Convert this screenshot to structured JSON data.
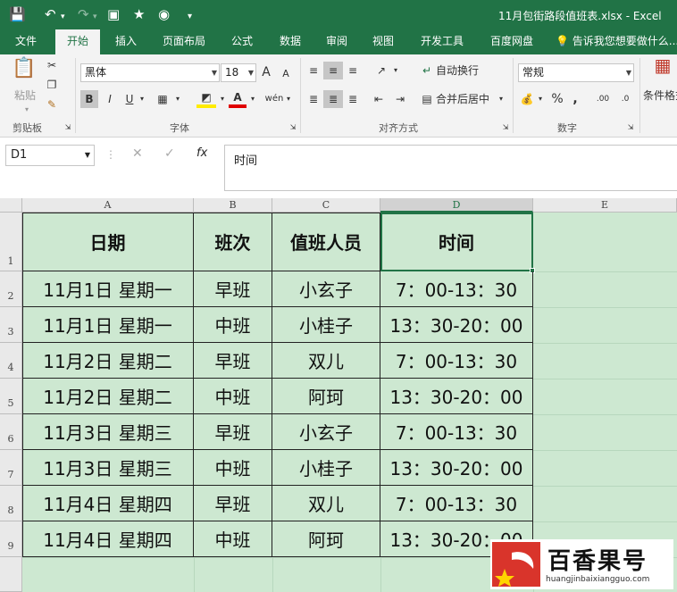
{
  "title_bar": {
    "doc_title": "11月包街路段值班表.xlsx - Excel"
  },
  "ribbon_tabs": [
    "文件",
    "开始",
    "插入",
    "页面布局",
    "公式",
    "数据",
    "审阅",
    "视图",
    "开发工具",
    "百度网盘"
  ],
  "tell_me": "告诉我您想要做什么...",
  "ribbon": {
    "paste_label": "粘贴",
    "clipboard_group": "剪贴板",
    "font_name": "黑体",
    "font_size": "18",
    "font_group": "字体",
    "wrap_label": "自动换行",
    "merge_label": "合并后居中",
    "align_group": "对齐方式",
    "number_format": "常规",
    "number_group": "数字",
    "cond_format_label": "条件格式",
    "bold": "B",
    "italic": "I",
    "underline": "U",
    "grow_font": "A",
    "shrink_font": "A",
    "percent": "%",
    "comma": ",",
    "dec_inc": ".00",
    "dec_dec": ".0"
  },
  "formula_bar": {
    "name_box": "D1",
    "fx": "fx",
    "content": "时间"
  },
  "columns": [
    "A",
    "B",
    "C",
    "D",
    "E"
  ],
  "rows": [
    "1",
    "2",
    "3",
    "4",
    "5",
    "6",
    "7",
    "8",
    "9"
  ],
  "headers": [
    "日期",
    "班次",
    "值班人员",
    "时间"
  ],
  "table": [
    [
      "11月1日 星期一",
      "早班",
      "小玄子",
      "7：00-13：30"
    ],
    [
      "11月1日 星期一",
      "中班",
      "小桂子",
      "13：30-20：00"
    ],
    [
      "11月2日 星期二",
      "早班",
      "双儿",
      "7：00-13：30"
    ],
    [
      "11月2日 星期二",
      "中班",
      "阿珂",
      "13：30-20：00"
    ],
    [
      "11月3日 星期三",
      "早班",
      "小玄子",
      "7：00-13：30"
    ],
    [
      "11月3日 星期三",
      "中班",
      "小桂子",
      "13：30-20：00"
    ],
    [
      "11月4日 星期四",
      "早班",
      "双儿",
      "7：00-13：30"
    ],
    [
      "11月4日 星期四",
      "中班",
      "阿珂",
      "13：30-20：00"
    ]
  ],
  "watermark": {
    "brand": "百香果号",
    "url": "huangjinbaixiangguo.com"
  },
  "colors": {
    "accent": "#217346",
    "sheet_bg": "#cde8d1"
  }
}
